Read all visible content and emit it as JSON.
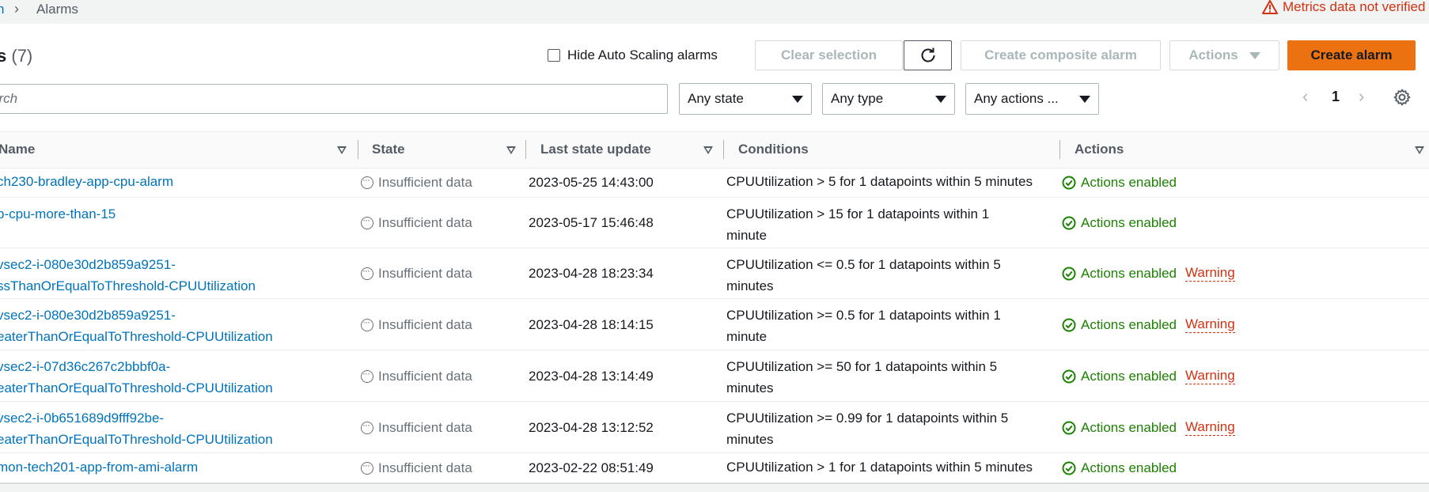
{
  "breadcrumb": {
    "parent_fragment": "n",
    "current": "Alarms"
  },
  "metrics_warning": "Metrics data not verified",
  "header": {
    "title_fragment": "s",
    "count": "(7)"
  },
  "toolbar": {
    "hide_autoscaling_label": "Hide Auto Scaling alarms",
    "clear_selection": "Clear selection",
    "create_composite": "Create composite alarm",
    "actions": "Actions",
    "create_alarm": "Create alarm"
  },
  "filters": {
    "search_placeholder": "arch",
    "state": "Any state",
    "type": "Any type",
    "actions": "Any actions ..."
  },
  "pagination": {
    "page": "1"
  },
  "columns": {
    "name": "Name",
    "state": "State",
    "last_update": "Last state update",
    "conditions": "Conditions",
    "actions": "Actions"
  },
  "rows": [
    {
      "name1": "ch230-bradley-app-cpu-alarm",
      "name2": "",
      "state": "Insufficient data",
      "date": "2023-05-25 14:43:00",
      "cond1": "CPUUtilization > 5 for 1 datapoints within 5 minutes",
      "cond2": "",
      "action": "Actions enabled",
      "warning": ""
    },
    {
      "name1": "p-cpu-more-than-15",
      "name2": "",
      "state": "Insufficient data",
      "date": "2023-05-17 15:46:48",
      "cond1": "CPUUtilization > 15 for 1 datapoints within 1",
      "cond2": "minute",
      "action": "Actions enabled",
      "warning": ""
    },
    {
      "name1": "vsec2-i-080e30d2b859a9251-",
      "name2": "ssThanOrEqualToThreshold-CPUUtilization",
      "state": "Insufficient data",
      "date": "2023-04-28 18:23:34",
      "cond1": "CPUUtilization <= 0.5 for 1 datapoints within 5",
      "cond2": "minutes",
      "action": "Actions enabled",
      "warning": "Warning"
    },
    {
      "name1": "vsec2-i-080e30d2b859a9251-",
      "name2": "eaterThanOrEqualToThreshold-CPUUtilization",
      "state": "Insufficient data",
      "date": "2023-04-28 18:14:15",
      "cond1": "CPUUtilization >= 0.5 for 1 datapoints within 1",
      "cond2": "minute",
      "action": "Actions enabled",
      "warning": "Warning"
    },
    {
      "name1": "vsec2-i-07d36c267c2bbbf0a-",
      "name2": "eaterThanOrEqualToThreshold-CPUUtilization",
      "state": "Insufficient data",
      "date": "2023-04-28 13:14:49",
      "cond1": "CPUUtilization >= 50 for 1 datapoints within 5",
      "cond2": "minutes",
      "action": "Actions enabled",
      "warning": "Warning"
    },
    {
      "name1": "vsec2-i-0b651689d9fff92be-",
      "name2": "eaterThanOrEqualToThreshold-CPUUtilization",
      "state": "Insufficient data",
      "date": "2023-04-28 13:12:52",
      "cond1": "CPUUtilization >= 0.99 for 1 datapoints within 5",
      "cond2": "minutes",
      "action": "Actions enabled",
      "warning": "Warning"
    },
    {
      "name1": "mon-tech201-app-from-ami-alarm",
      "name2": "",
      "state": "Insufficient data",
      "date": "2023-02-22 08:51:49",
      "cond1": "CPUUtilization > 1 for 1 datapoints within 5 minutes",
      "cond2": "",
      "action": "Actions enabled",
      "warning": ""
    }
  ],
  "colors": {
    "link": "#0073bb",
    "success": "#1d8102",
    "error": "#d13212",
    "primary": "#ec7211"
  },
  "icons": {
    "state": "insufficient-data-icon",
    "action": "check-circle-icon",
    "warning": "warning-triangle-icon"
  }
}
